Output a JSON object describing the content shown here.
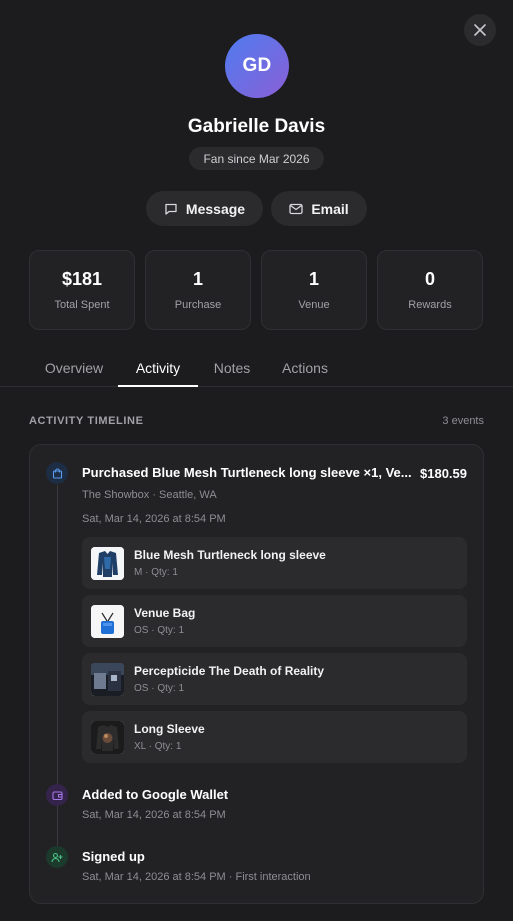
{
  "profile": {
    "initials": "GD",
    "name": "Gabrielle Davis",
    "since": "Fan since Mar 2026"
  },
  "actions": {
    "message_label": "Message",
    "email_label": "Email"
  },
  "stats": [
    {
      "value": "$181",
      "label": "Total Spent"
    },
    {
      "value": "1",
      "label": "Purchase"
    },
    {
      "value": "1",
      "label": "Venue"
    },
    {
      "value": "0",
      "label": "Rewards"
    }
  ],
  "tabs": [
    {
      "label": "Overview"
    },
    {
      "label": "Activity"
    },
    {
      "label": "Notes"
    },
    {
      "label": "Actions"
    }
  ],
  "active_tab": "Activity",
  "timeline": {
    "title": "ACTIVITY TIMELINE",
    "count": "3 events",
    "events": [
      {
        "title": "Purchased Blue Mesh Turtleneck long sleeve ×1, Ve...",
        "amount": "$180.59",
        "location": "The Showbox · Seattle, WA",
        "time": "Sat, Mar 14, 2026 at 8:54 PM",
        "items": [
          {
            "name": "Blue Mesh Turtleneck long sleeve",
            "meta": "M · Qty: 1"
          },
          {
            "name": "Venue Bag",
            "meta": "OS · Qty: 1"
          },
          {
            "name": "Percepticide The Death of Reality",
            "meta": "OS · Qty: 1"
          },
          {
            "name": "Long Sleeve",
            "meta": "XL · Qty: 1"
          }
        ]
      },
      {
        "title": "Added to Google Wallet",
        "time": "Sat, Mar 14, 2026 at 8:54 PM"
      },
      {
        "title": "Signed up",
        "time": "Sat, Mar 14, 2026 at 8:54 PM · First interaction"
      }
    ]
  },
  "colors": {
    "background": "#1c1c1e",
    "card": "#222225",
    "avatar_gradient_start": "#4f7cf0",
    "avatar_gradient_end": "#8a5fd6",
    "dot_purchase": "#5b9cf0",
    "dot_wallet": "#a77ae6",
    "dot_signup": "#4cc38a"
  },
  "icons": {
    "close": "close-icon",
    "message": "chat-bubble-icon",
    "email": "mail-icon",
    "purchase": "shopping-bag-icon",
    "wallet": "wallet-icon",
    "signup": "user-plus-icon"
  }
}
